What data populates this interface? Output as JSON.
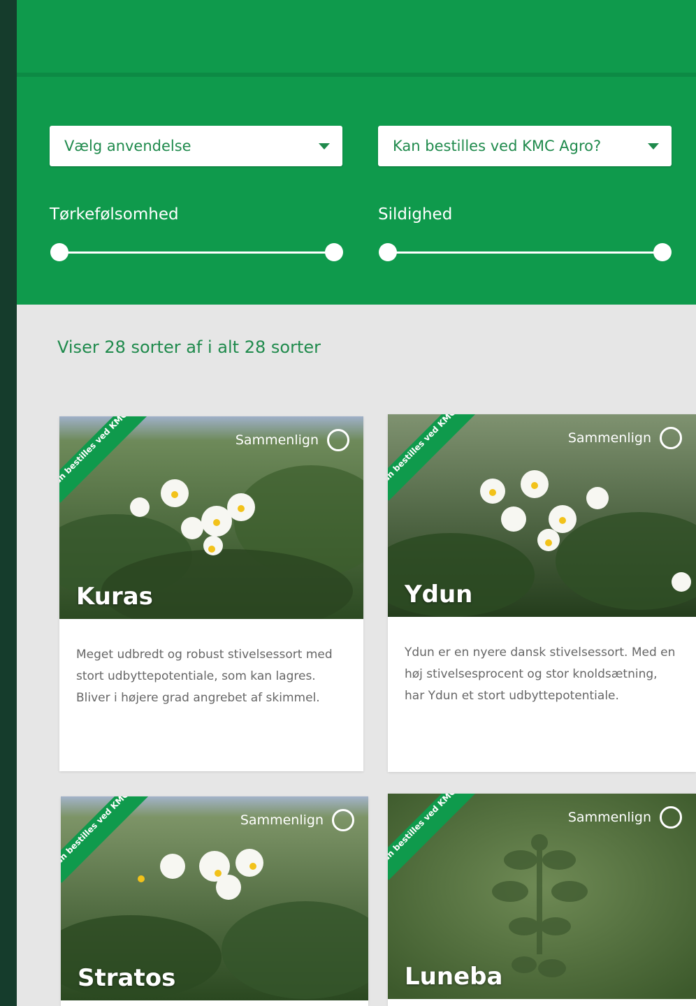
{
  "filters": {
    "select_use": {
      "label": "Vælg anvendelse"
    },
    "select_order": {
      "label": "Kan bestilles ved KMC Agro?"
    },
    "slider_drought": {
      "label": "Tørkefølsomhed",
      "min": 0,
      "max": 1
    },
    "slider_lateness": {
      "label": "Sildighed",
      "min": 0,
      "max": 1
    }
  },
  "results": {
    "count_text": "Viser 28 sorter af i alt 28 sorter"
  },
  "cards": [
    {
      "name": "Kuras",
      "ribbon": "Kan bestilles ved KMC Agro",
      "compare": "Sammenlign",
      "description": "Meget udbredt og robust stivelsessort med stort udbyttepotentiale, som kan lagres. Bliver i højere grad angrebet af skimmel."
    },
    {
      "name": "Ydun",
      "ribbon": "Kan bestilles ved KMC Agro",
      "compare": "Sammenlign",
      "description": "Ydun er en nyere dansk stivelsessort. Med en høj stivelsesprocent og stor knoldsætning, har Ydun et stort udbyttepotentiale."
    },
    {
      "name": "Stratos",
      "ribbon": "Kan bestilles ved KMC Agro",
      "compare": "Sammenlign",
      "description": ""
    },
    {
      "name": "Luneba",
      "ribbon": "Kan bestilles ved KMC Agro",
      "compare": "Sammenlign",
      "description": ""
    }
  ],
  "colors": {
    "brand_green": "#0f9a4c",
    "dark_sidebar": "#153c2c",
    "page_bg": "#e6e6e6"
  }
}
